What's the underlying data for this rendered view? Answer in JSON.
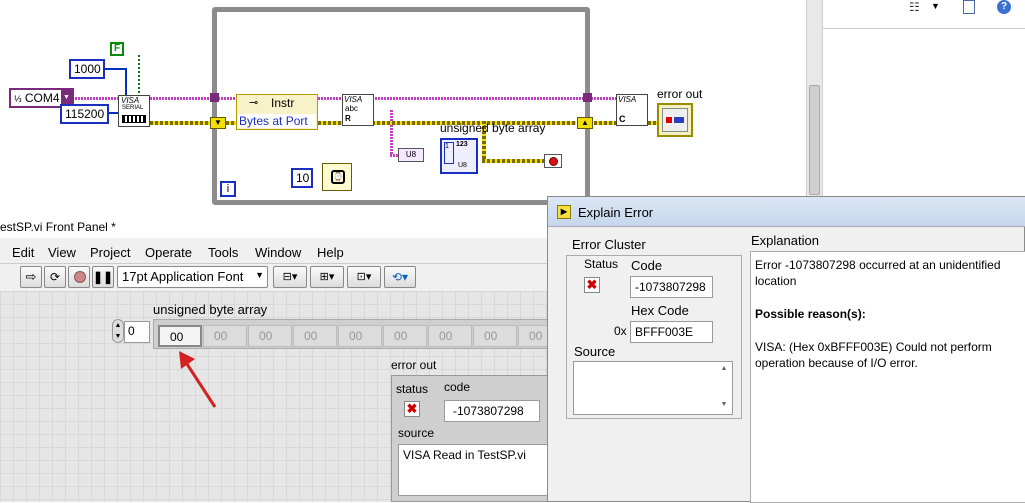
{
  "block_diagram": {
    "constants": {
      "bool_f": "F",
      "timeout": "1000",
      "port": "COM4",
      "baud": "115200",
      "wait_ms": "10"
    },
    "labels": {
      "visa_serial": "VISA",
      "serial_sub": "SERIAL",
      "instr_property": "Instr",
      "bytes_at_port": "Bytes at Port",
      "visa_read": "VISA",
      "read_sub": "abc",
      "visa_close": "VISA",
      "unsigned_byte_array": "unsigned byte array",
      "error_out": "error out",
      "loop_iteration": "i",
      "u8_type": "U8",
      "array_123": "123"
    }
  },
  "right_panel": {
    "icons": [
      "list-view-icon",
      "dropdown-icon",
      "page-icon",
      "help-icon"
    ]
  },
  "front_panel": {
    "window_title": "estSP.vi Front Panel *",
    "menu": [
      "Edit",
      "View",
      "Project",
      "Operate",
      "Tools",
      "Window",
      "Help"
    ],
    "font_select": "17pt Application Font",
    "array_label": "unsigned byte array",
    "array_index": "0",
    "array_values": [
      "00",
      "00",
      "00",
      "00",
      "00",
      "00",
      "00",
      "00",
      "00"
    ],
    "error_cluster": {
      "label": "error out",
      "status_label": "status",
      "code_label": "code",
      "code_value": "-1073807298",
      "source_label": "source",
      "source_value": "VISA Read in TestSP.vi"
    }
  },
  "dialog": {
    "title": "Explain Error",
    "cluster_title": "Error Cluster",
    "status_label": "Status",
    "code_label": "Code",
    "code_value": "-1073807298",
    "hex_code_label": "Hex Code",
    "hex_prefix": "0x",
    "hex_value": "BFFF003E",
    "source_label": "Source",
    "source_value": "",
    "explanation_label": "Explanation",
    "explanation_line1": "Error -1073807298 occurred at an unidentified",
    "explanation_line2": "location",
    "possible_reasons": "Possible reason(s):",
    "reason_line1": "VISA:  (Hex 0xBFFF003E) Could not perform",
    "reason_line2": "operation because of I/O error."
  },
  "colors": {
    "visa_wire": "#c040c0",
    "error_wire": "#f2e000",
    "int_wire": "#0030c0",
    "annotation_arrow": "#d42020",
    "error_x": "#d00000"
  }
}
